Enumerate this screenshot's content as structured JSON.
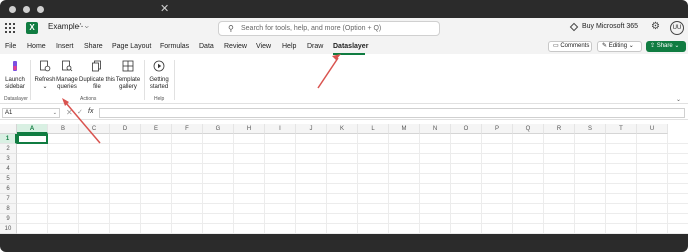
{
  "header": {
    "filename": "Example",
    "search_placeholder": "Search for tools, help, and more (Option + Q)",
    "ms365_label": "Buy Microsoft 365",
    "avatar_initials": "UU"
  },
  "tabs": [
    {
      "label": "File"
    },
    {
      "label": "Home"
    },
    {
      "label": "Insert"
    },
    {
      "label": "Share"
    },
    {
      "label": "Page Layout"
    },
    {
      "label": "Formulas"
    },
    {
      "label": "Data"
    },
    {
      "label": "Review"
    },
    {
      "label": "View"
    },
    {
      "label": "Help"
    },
    {
      "label": "Draw"
    },
    {
      "label": "Dataslayer",
      "active": true
    }
  ],
  "right_buttons": {
    "comments": "Comments",
    "editing": "Editing",
    "share": "Share"
  },
  "ribbon": {
    "groups": [
      {
        "name": "Dataslayer",
        "buttons": [
          {
            "label1": "Launch",
            "label2": "sidebar",
            "icon": "dataslayer-logo-icon"
          }
        ]
      },
      {
        "name": "Actions",
        "buttons": [
          {
            "label1": "Refresh",
            "label2": "⌄",
            "icon": "refresh-doc-icon"
          },
          {
            "label1": "Manage",
            "label2": "queries",
            "icon": "manage-queries-icon"
          },
          {
            "label1": "Duplicate this",
            "label2": "file",
            "icon": "duplicate-icon"
          },
          {
            "label1": "Template",
            "label2": "gallery",
            "icon": "template-gallery-icon"
          }
        ]
      },
      {
        "name": "Help",
        "buttons": [
          {
            "label1": "Getting",
            "label2": "started",
            "icon": "play-circle-icon"
          }
        ]
      }
    ]
  },
  "formula_bar": {
    "name_box": "A1",
    "fx": "fx"
  },
  "columns": [
    "A",
    "B",
    "C",
    "D",
    "E",
    "F",
    "G",
    "H",
    "I",
    "J",
    "K",
    "L",
    "M",
    "N",
    "O",
    "P",
    "Q",
    "R",
    "S",
    "T",
    "U"
  ],
  "rows": [
    "1",
    "2",
    "3",
    "4",
    "5",
    "6",
    "7",
    "8",
    "9",
    "10"
  ],
  "colors": {
    "accent": "#107c41",
    "annotation_arrow": "#d9534f"
  }
}
